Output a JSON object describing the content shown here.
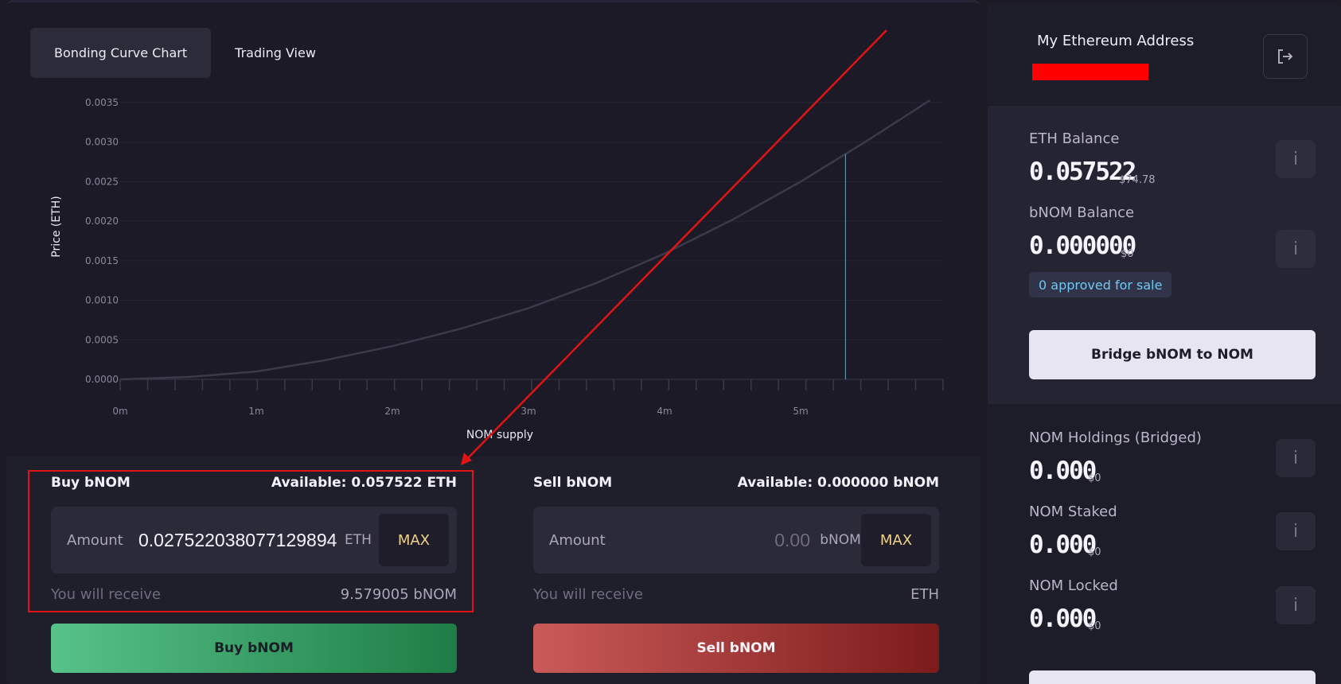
{
  "tabs": [
    {
      "label": "Bonding Curve Chart",
      "active": true
    },
    {
      "label": "Trading View",
      "active": false
    }
  ],
  "chart_data": {
    "type": "line",
    "xlabel": "NOM supply",
    "ylabel": "Price (ETH)",
    "xticks": [
      "0m",
      "1m",
      "2m",
      "3m",
      "4m",
      "5m"
    ],
    "yticks": [
      "0.0000",
      "0.0005",
      "0.0010",
      "0.0015",
      "0.0020",
      "0.0025",
      "0.0030",
      "0.0035"
    ],
    "xlim": [
      0,
      6
    ],
    "ylim": [
      0,
      0.0035
    ],
    "series": [
      {
        "x": [
          0,
          0.5,
          1,
          1.5,
          2,
          2.5,
          3,
          3.5,
          4,
          4.5,
          5,
          5.5,
          5.95
        ],
        "y": [
          0,
          3e-05,
          0.0001,
          0.00024,
          0.00042,
          0.00064,
          0.0009,
          0.00122,
          0.00159,
          0.00202,
          0.0025,
          0.00303,
          0.00353
        ]
      }
    ],
    "marker_x": 5.33,
    "marker_y": 0.00285
  },
  "buy": {
    "title": "Buy bNOM",
    "available": "Available: 0.057522 ETH",
    "amount_label": "Amount",
    "amount_value": "0.0275220380771298948",
    "unit": "ETH",
    "max_label": "MAX",
    "receive_label": "You will receive",
    "receive_value": "9.579005 bNOM",
    "button": "Buy bNOM"
  },
  "sell": {
    "title": "Sell bNOM",
    "available": "Available: 0.000000 bNOM",
    "amount_label": "Amount",
    "amount_placeholder": "0.00",
    "unit": "bNOM",
    "max_label": "MAX",
    "receive_label": "You will receive",
    "receive_value": "ETH",
    "button": "Sell bNOM"
  },
  "account": {
    "title": "My Ethereum Address"
  },
  "balances": {
    "eth_label": "ETH Balance",
    "eth_value": "0.057522",
    "eth_usd": "$74.78",
    "bnom_label": "bNOM Balance",
    "bnom_value": "0.000000",
    "bnom_usd": "$0",
    "approved": "0 approved for sale",
    "bridge_button": "Bridge bNOM to NOM",
    "info_glyph": "i"
  },
  "holdings": {
    "bridged_label": "NOM Holdings (Bridged)",
    "bridged_value": "0.000",
    "bridged_usd": "$0",
    "staked_label": "NOM Staked",
    "staked_value": "0.000",
    "staked_usd": "$0",
    "locked_label": "NOM Locked",
    "locked_value": "0.000",
    "locked_usd": "$0"
  },
  "colors": {
    "highlight": "#e11414",
    "curve": "#3b3a4b",
    "marker": "#5f8fa6"
  }
}
